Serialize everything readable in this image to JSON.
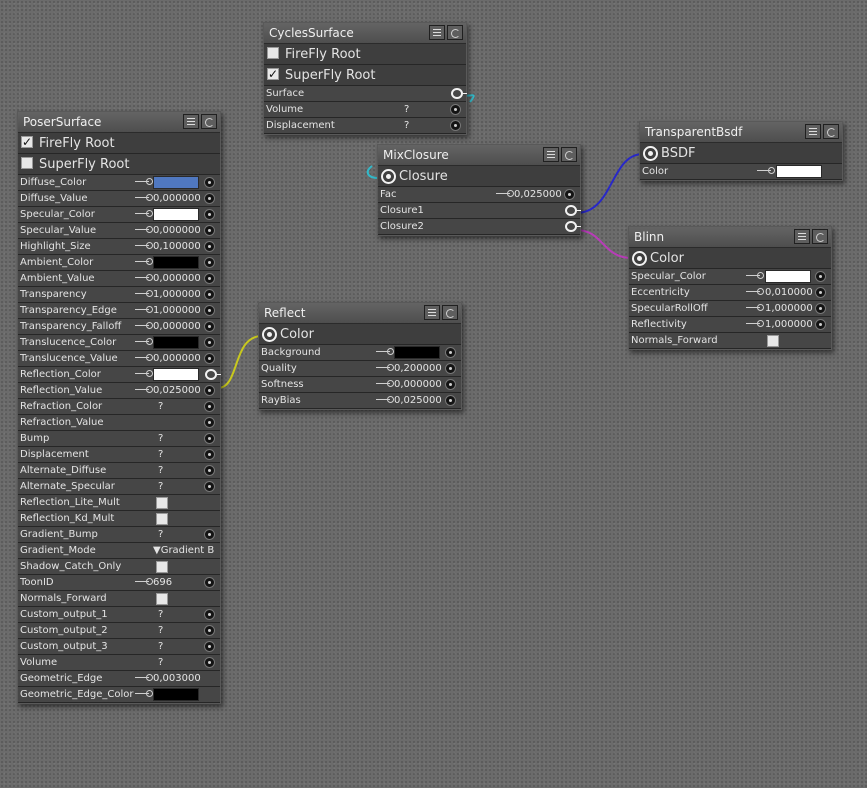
{
  "colors": {
    "wire_cyan": "#33b8c8",
    "wire_yellow": "#c8c81e",
    "wire_blue": "#2828c8",
    "wire_magenta": "#b83cb8",
    "diffuse_swatch": "#5078c0",
    "white_swatch": "#ffffff",
    "black_swatch": "#000000"
  },
  "cycles": {
    "title": "CyclesSurface",
    "firefly_label": "FireFly Root",
    "superfly_label": "SuperFly Root",
    "superfly_check": "✓",
    "rows": [
      {
        "label": "Surface"
      },
      {
        "label": "Volume",
        "q": "?"
      },
      {
        "label": "Displacement",
        "q": "?"
      }
    ]
  },
  "poser": {
    "title": "PoserSurface",
    "firefly_label": "FireFly Root",
    "firefly_check": "✓",
    "superfly_label": "SuperFly Root",
    "rows": [
      {
        "label": "Diffuse_Color",
        "kind": "swatch",
        "swatch": "diffuse"
      },
      {
        "label": "Diffuse_Value",
        "kind": "num",
        "value": "0,000000"
      },
      {
        "label": "Specular_Color",
        "kind": "swatch",
        "swatch": "white"
      },
      {
        "label": "Specular_Value",
        "kind": "num",
        "value": "0,000000"
      },
      {
        "label": "Highlight_Size",
        "kind": "num",
        "value": "0,100000"
      },
      {
        "label": "Ambient_Color",
        "kind": "swatch",
        "swatch": "black"
      },
      {
        "label": "Ambient_Value",
        "kind": "num",
        "value": "0,000000"
      },
      {
        "label": "Transparency",
        "kind": "num",
        "value": "1,000000"
      },
      {
        "label": "Transparency_Edge",
        "kind": "num",
        "value": "1,000000"
      },
      {
        "label": "Transparency_Falloff",
        "kind": "num",
        "value": "0,000000"
      },
      {
        "label": "Translucence_Color",
        "kind": "swatch",
        "swatch": "black"
      },
      {
        "label": "Translucence_Value",
        "kind": "num",
        "value": "0,000000"
      },
      {
        "label": "Reflection_Color",
        "kind": "swatch",
        "swatch": "white"
      },
      {
        "label": "Reflection_Value",
        "kind": "num",
        "value": "0,025000"
      },
      {
        "label": "Refraction_Color",
        "kind": "q",
        "value": "?"
      },
      {
        "label": "Refraction_Value",
        "kind": "empty"
      },
      {
        "label": "Bump",
        "kind": "q",
        "value": "?"
      },
      {
        "label": "Displacement",
        "kind": "q",
        "value": "?"
      },
      {
        "label": "Alternate_Diffuse",
        "kind": "q",
        "value": "?"
      },
      {
        "label": "Alternate_Specular",
        "kind": "q",
        "value": "?"
      },
      {
        "label": "Reflection_Lite_Mult",
        "kind": "check"
      },
      {
        "label": "Reflection_Kd_Mult",
        "kind": "check"
      },
      {
        "label": "Gradient_Bump",
        "kind": "q",
        "value": "?"
      },
      {
        "label": "Gradient_Mode",
        "kind": "dropdown",
        "value": "▼Gradient B"
      },
      {
        "label": "Shadow_Catch_Only",
        "kind": "check"
      },
      {
        "label": "ToonID",
        "kind": "num",
        "value": "696"
      },
      {
        "label": "Normals_Forward",
        "kind": "check"
      },
      {
        "label": "Custom_output_1",
        "kind": "q",
        "value": "?"
      },
      {
        "label": "Custom_output_2",
        "kind": "q",
        "value": "?"
      },
      {
        "label": "Custom_output_3",
        "kind": "q",
        "value": "?"
      },
      {
        "label": "Volume",
        "kind": "q",
        "value": "?"
      },
      {
        "label": "Geometric_Edge",
        "kind": "num",
        "value": "0,003000"
      },
      {
        "label": "Geometric_Edge_Color",
        "kind": "swatch",
        "swatch": "black"
      }
    ]
  },
  "mix": {
    "title": "MixClosure",
    "output_label": "Closure",
    "rows": [
      {
        "label": "Fac",
        "value": "0,025000"
      },
      {
        "label": "Closure1"
      },
      {
        "label": "Closure2"
      }
    ]
  },
  "reflect": {
    "title": "Reflect",
    "output_label": "Color",
    "rows": [
      {
        "label": "Background"
      },
      {
        "label": "Quality",
        "value": "0,200000"
      },
      {
        "label": "Softness",
        "value": "0,000000"
      },
      {
        "label": "RayBias",
        "value": "0,025000"
      }
    ]
  },
  "transparent": {
    "title": "TransparentBsdf",
    "output_label": "BSDF",
    "rows": [
      {
        "label": "Color"
      }
    ]
  },
  "blinn": {
    "title": "Blinn",
    "output_label": "Color",
    "rows": [
      {
        "label": "Specular_Color"
      },
      {
        "label": "Eccentricity",
        "value": "0,010000"
      },
      {
        "label": "SpecularRollOff",
        "value": "1,000000"
      },
      {
        "label": "Reflectivity",
        "value": "1,000000"
      },
      {
        "label": "Normals_Forward"
      }
    ]
  }
}
